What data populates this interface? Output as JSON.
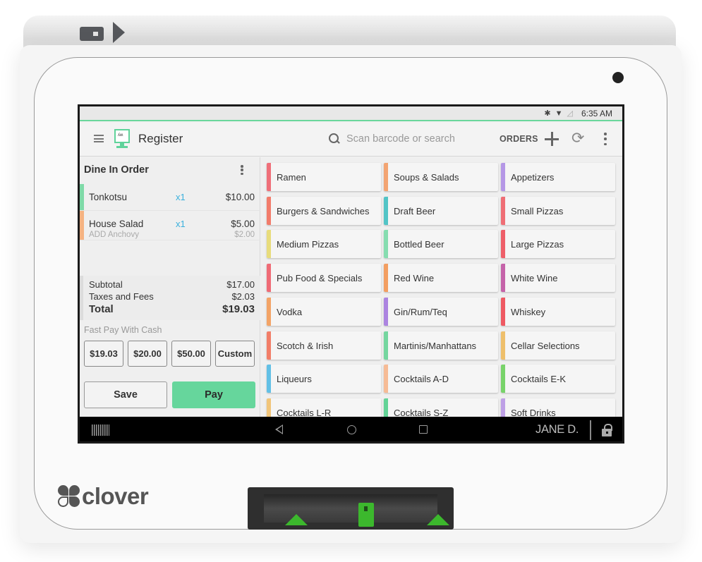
{
  "device": {
    "brand": "clover"
  },
  "status_bar": {
    "bluetooth_icon": "bluetooth-icon",
    "wifi_icon": "wifi-icon",
    "signal_icon": "cell-signal-icon",
    "time": "6:35 AM"
  },
  "app_bar": {
    "title": "Register",
    "search_placeholder": "Scan barcode or search",
    "search_value": "",
    "orders_label": "ORDERS",
    "icons": [
      "menu-icon",
      "register-icon",
      "search-icon",
      "plus-icon",
      "sync-icon",
      "overflow-icon"
    ]
  },
  "order": {
    "title": "Dine In Order",
    "items": [
      {
        "name": "Tonkotsu",
        "qty": "x1",
        "price": "$10.00",
        "color": "#7fdaa8"
      },
      {
        "name": "House Salad",
        "qty": "x1",
        "price": "$5.00",
        "modifier": "ADD Anchovy",
        "modifier_price": "$2.00",
        "color": "#f5b382"
      }
    ],
    "subtotal_label": "Subtotal",
    "subtotal": "$17.00",
    "taxes_label": "Taxes and Fees",
    "taxes": "$2.03",
    "total_label": "Total",
    "total": "$19.03",
    "fast_pay_label": "Fast Pay With Cash",
    "fast_pay_options": [
      "$19.03",
      "$20.00",
      "$50.00",
      "Custom"
    ],
    "save_label": "Save",
    "pay_label": "Pay",
    "pay_color": "#66d69c"
  },
  "categories": [
    {
      "label": "Ramen",
      "color": "#ef6f79"
    },
    {
      "label": "Soups & Salads",
      "color": "#f3a472"
    },
    {
      "label": "Appetizers",
      "color": "#b597e6"
    },
    {
      "label": "Burgers & Sandwiches",
      "color": "#f27c6b"
    },
    {
      "label": "Draft Beer",
      "color": "#52c4c6"
    },
    {
      "label": "Small Pizzas",
      "color": "#ef6e75"
    },
    {
      "label": "Medium Pizzas",
      "color": "#e8dc7c"
    },
    {
      "label": "Bottled Beer",
      "color": "#86ddb0"
    },
    {
      "label": "Large Pizzas",
      "color": "#ee5f69"
    },
    {
      "label": "Pub Food & Specials",
      "color": "#ef6b76"
    },
    {
      "label": "Red Wine",
      "color": "#f39e61"
    },
    {
      "label": "White Wine",
      "color": "#c563a9"
    },
    {
      "label": "Vodka",
      "color": "#f3a467"
    },
    {
      "label": "Gin/Rum/Teq",
      "color": "#ac84e0"
    },
    {
      "label": "Whiskey",
      "color": "#ee5962"
    },
    {
      "label": "Scotch & Irish",
      "color": "#f27e68"
    },
    {
      "label": "Martinis/Manhattans",
      "color": "#74d69f"
    },
    {
      "label": "Cellar Selections",
      "color": "#eebf6b"
    },
    {
      "label": "Liqueurs",
      "color": "#62c0e6"
    },
    {
      "label": "Cocktails A-D",
      "color": "#f6bb95"
    },
    {
      "label": "Cocktails E-K",
      "color": "#78d36a"
    },
    {
      "label": "Cocktails L-R",
      "color": "#f1c57a"
    },
    {
      "label": "Cocktails S-Z",
      "color": "#63d396"
    },
    {
      "label": "Soft Drinks",
      "color": "#bea0e6"
    }
  ],
  "nav_bar": {
    "employee_name": "JANE D.",
    "icons": [
      "barcode-icon",
      "back-icon",
      "home-icon",
      "recents-icon",
      "lock-icon"
    ]
  },
  "card_reader": {
    "accent_color": "#3cb82d"
  }
}
